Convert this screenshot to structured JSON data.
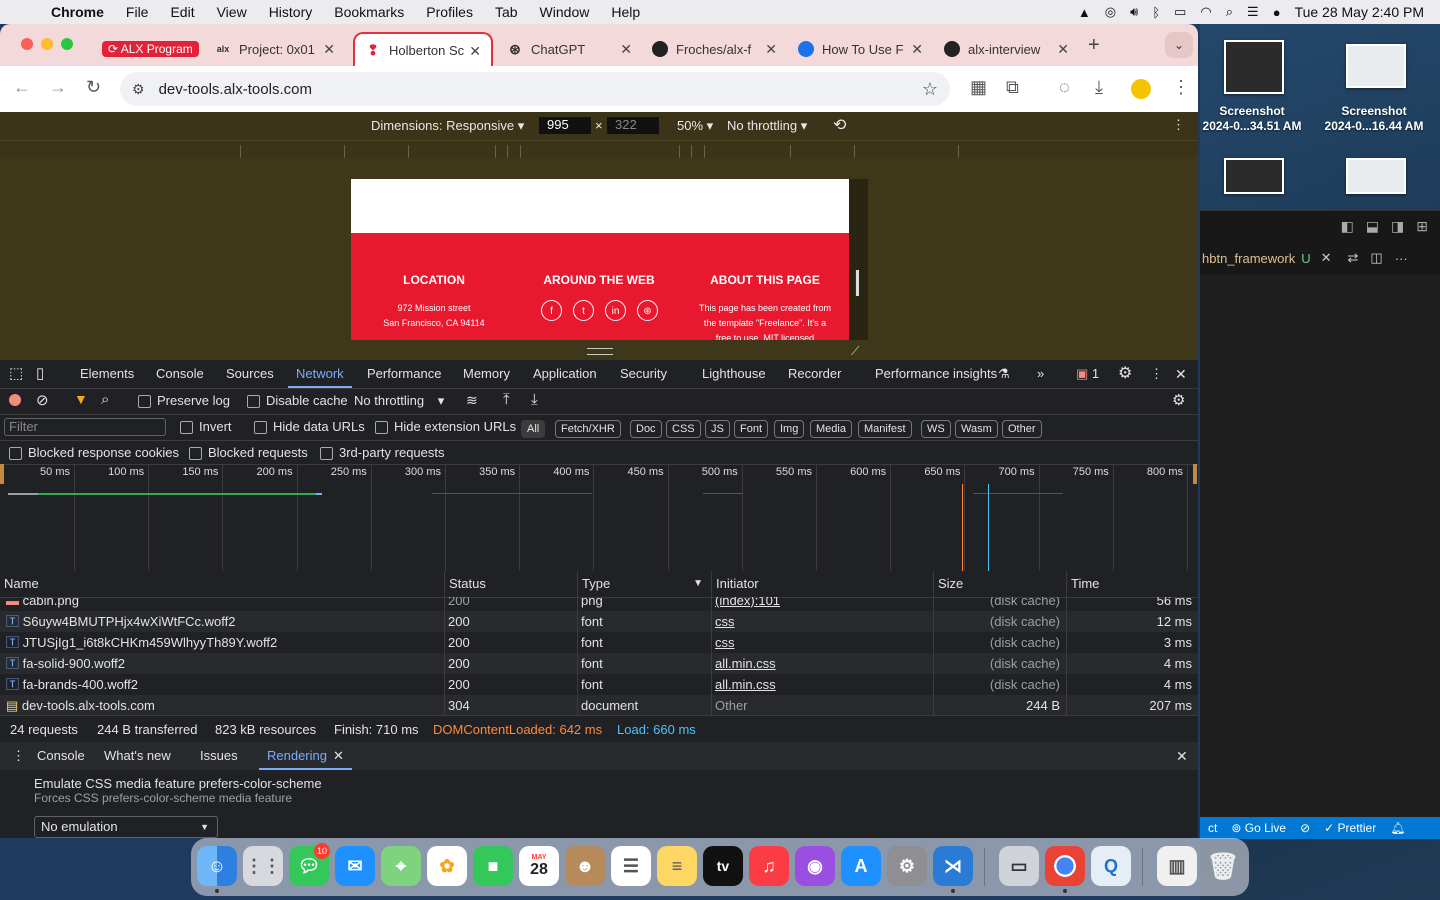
{
  "menubar": {
    "app": "Chrome",
    "items": [
      "File",
      "Edit",
      "View",
      "History",
      "Bookmarks",
      "Profiles",
      "Tab",
      "Window",
      "Help"
    ],
    "datetime": "Tue 28 May  2:40 PM"
  },
  "desktop": {
    "icons": [
      {
        "label1": "Screenshot",
        "label2": "2024-0...34.51 AM"
      },
      {
        "label1": "Screenshot",
        "label2": "2024-0...16.44 AM"
      }
    ]
  },
  "vscode": {
    "tab_label": "hbtn_framework",
    "tab_status": "U",
    "status_items": [
      "Go Live",
      "Prettier"
    ],
    "status_prefix": "ct"
  },
  "browser": {
    "tabs": [
      {
        "label": "ALX Program"
      },
      {
        "label": "Project: 0x01"
      },
      {
        "label": "Holberton Sc"
      },
      {
        "label": "ChatGPT"
      },
      {
        "label": "Froches/alx-f"
      },
      {
        "label": "How To Use F"
      },
      {
        "label": "alx-interview"
      }
    ],
    "url": "dev-tools.alx-tools.com"
  },
  "device_toolbar": {
    "dimensions_label": "Dimensions: Responsive",
    "width": "995",
    "height": "322",
    "zoom": "50%",
    "throttling": "No throttling"
  },
  "site": {
    "columns": [
      {
        "title": "LOCATION",
        "lines": [
          "972 Mission street",
          "San Francisco, CA 94114"
        ]
      },
      {
        "title": "AROUND THE WEB",
        "lines": []
      },
      {
        "title": "ABOUT THIS PAGE",
        "lines": [
          "This page has been created from",
          "the template \"Freelance\". It's a",
          "free to use, MIT licensed"
        ]
      }
    ],
    "social_icons": [
      "f",
      "t",
      "in",
      "⊛"
    ]
  },
  "devtools": {
    "panel_tabs": [
      "Elements",
      "Console",
      "Sources",
      "Network",
      "Performance",
      "Memory",
      "Application",
      "Security",
      "Lighthouse",
      "Recorder",
      "Performance insights"
    ],
    "selected_tab": "Network",
    "error_count": "1",
    "network_toolbar": {
      "preserve_log": "Preserve log",
      "disable_cache": "Disable cache",
      "throttling": "No throttling"
    },
    "filter": {
      "placeholder": "Filter",
      "invert": "Invert",
      "hide_data_urls": "Hide data URLs",
      "hide_extension_urls": "Hide extension URLs",
      "types": [
        "All",
        "Fetch/XHR",
        "Doc",
        "CSS",
        "JS",
        "Font",
        "Img",
        "Media",
        "Manifest",
        "WS",
        "Wasm",
        "Other"
      ]
    },
    "blocked": {
      "blocked_response_cookies": "Blocked response cookies",
      "blocked_requests": "Blocked requests",
      "third_party": "3rd-party requests"
    },
    "timeline_ticks": [
      "50 ms",
      "100 ms",
      "150 ms",
      "200 ms",
      "250 ms",
      "300 ms",
      "350 ms",
      "400 ms",
      "450 ms",
      "500 ms",
      "550 ms",
      "600 ms",
      "650 ms",
      "700 ms",
      "750 ms",
      "800 ms"
    ],
    "table": {
      "headers": [
        "Name",
        "Status",
        "Type",
        "Initiator",
        "Size",
        "Time"
      ],
      "rows": [
        {
          "name": "cabin.png",
          "status": "200",
          "type": "png",
          "initiator": "(index):101",
          "size": "(disk cache)",
          "time": "56 ms"
        },
        {
          "name": "S6uyw4BMUTPHjx4wXiWtFCc.woff2",
          "status": "200",
          "type": "font",
          "initiator": "css",
          "size": "(disk cache)",
          "time": "12 ms"
        },
        {
          "name": "JTUSjIg1_i6t8kCHKm459WlhyyTh89Y.woff2",
          "status": "200",
          "type": "font",
          "initiator": "css",
          "size": "(disk cache)",
          "time": "3 ms"
        },
        {
          "name": "fa-solid-900.woff2",
          "status": "200",
          "type": "font",
          "initiator": "all.min.css",
          "size": "(disk cache)",
          "time": "4 ms"
        },
        {
          "name": "fa-brands-400.woff2",
          "status": "200",
          "type": "font",
          "initiator": "all.min.css",
          "size": "(disk cache)",
          "time": "4 ms"
        },
        {
          "name": "dev-tools.alx-tools.com",
          "status": "304",
          "type": "document",
          "initiator": "Other",
          "size": "244 B",
          "time": "207 ms"
        }
      ]
    },
    "summary": {
      "requests": "24 requests",
      "transferred": "244 B transferred",
      "resources": "823 kB resources",
      "finish": "Finish: 710 ms",
      "dom_loaded": "DOMContentLoaded: 642 ms",
      "load": "Load: 660 ms"
    },
    "drawer": {
      "tabs": [
        "Console",
        "What's new",
        "Issues",
        "Rendering"
      ],
      "selected": "Rendering",
      "setting_title": "Emulate CSS media feature prefers-color-scheme",
      "setting_desc": "Forces CSS prefers-color-scheme media feature",
      "select_value": "No emulation"
    }
  },
  "dock": {
    "messages_badge": "10",
    "calendar_month": "MAY",
    "calendar_day": "28",
    "tv_label": "tv"
  },
  "colors": {
    "accent_red": "#e8182f",
    "devtools_bg": "#202124",
    "link_blue": "#7cacf8",
    "dom_loaded": "#ff8a3d",
    "load": "#4fc3f7"
  }
}
